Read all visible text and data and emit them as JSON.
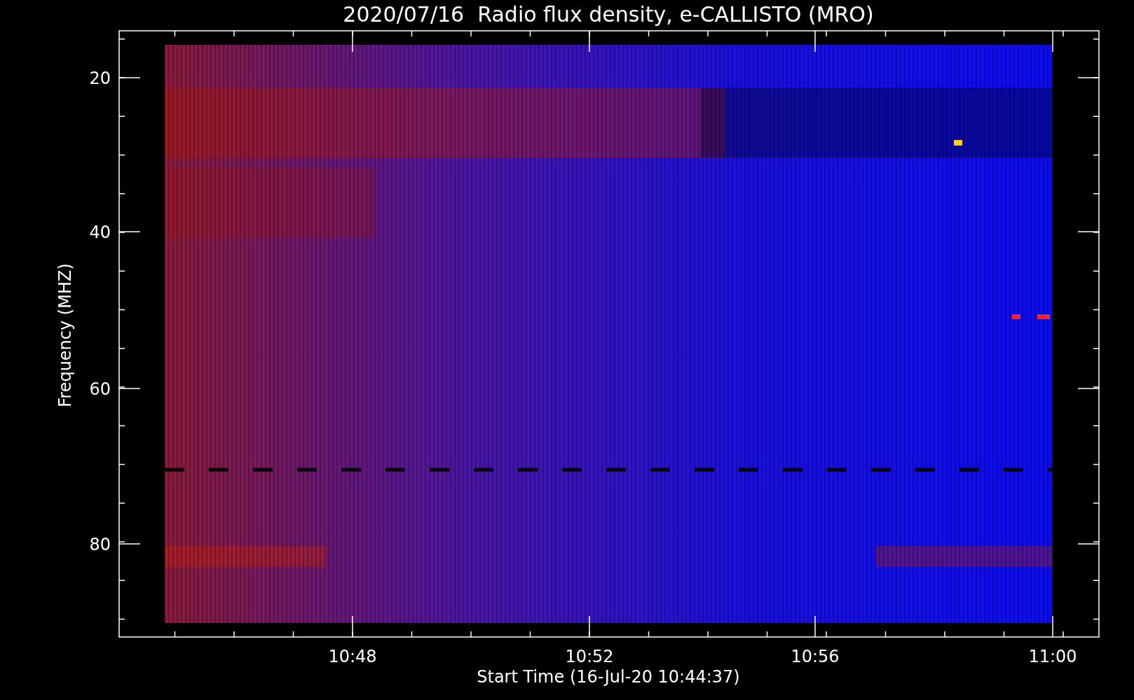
{
  "title": "2020/07/16  Radio flux density, e-CALLISTO (MRO)",
  "y_axis": {
    "label": "Frequency (MHZ)",
    "ticks": [
      "20",
      "40",
      "60",
      "80"
    ]
  },
  "x_axis": {
    "label": "Start Time (16-Jul-20 10:44:37)",
    "ticks": [
      "10:48",
      "10:52",
      "10:56",
      "11:00"
    ]
  }
}
